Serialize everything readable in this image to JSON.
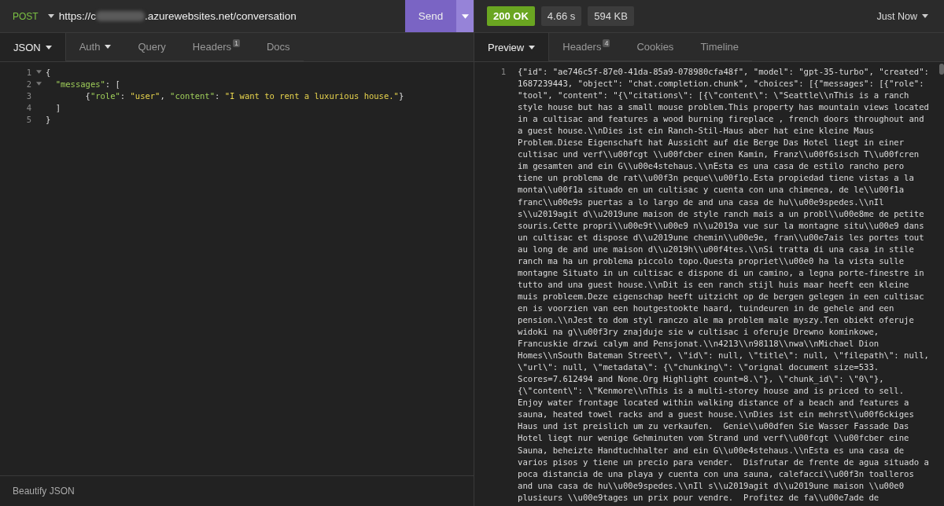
{
  "request": {
    "method": "POST",
    "url_start": "https://c",
    "url_end": ".azurewebsites.net/conversation",
    "send": "Send"
  },
  "request_tabs": [
    {
      "label": "JSON",
      "selected": true,
      "dropdown": true
    },
    {
      "label": "Auth",
      "selected": false,
      "dropdown": true
    },
    {
      "label": "Query",
      "selected": false,
      "dropdown": false
    },
    {
      "label": "Headers",
      "selected": false,
      "dropdown": false,
      "badge": "1"
    },
    {
      "label": "Docs",
      "selected": false,
      "dropdown": false
    }
  ],
  "editor": {
    "lines": [
      {
        "number": "1",
        "foldable": true,
        "tokens": [
          {
            "text": "{",
            "kind": "punct"
          }
        ]
      },
      {
        "number": "2",
        "foldable": true,
        "tokens": [
          {
            "text": "  \"messages\"",
            "kind": "key"
          },
          {
            "text": ": [",
            "kind": "punct"
          }
        ]
      },
      {
        "number": "3",
        "foldable": false,
        "tokens": [
          {
            "text": "        {",
            "kind": "punct"
          },
          {
            "text": "\"role\"",
            "kind": "key"
          },
          {
            "text": ": ",
            "kind": "punct"
          },
          {
            "text": "\"user\"",
            "kind": "string"
          },
          {
            "text": ", ",
            "kind": "punct"
          },
          {
            "text": "\"content\"",
            "kind": "key"
          },
          {
            "text": ": ",
            "kind": "punct"
          },
          {
            "text": "\"I want to rent a luxurious house.\"",
            "kind": "string"
          },
          {
            "text": "}",
            "kind": "punct"
          }
        ]
      },
      {
        "number": "4",
        "foldable": false,
        "tokens": [
          {
            "text": "  ]",
            "kind": "punct"
          }
        ]
      },
      {
        "number": "5",
        "foldable": false,
        "tokens": [
          {
            "text": "}",
            "kind": "punct"
          }
        ]
      }
    ],
    "footer": "Beautify JSON"
  },
  "response": {
    "status": "200 OK",
    "time": "4.66 s",
    "size": "594 KB",
    "when": "Just Now"
  },
  "response_tabs": [
    {
      "label": "Preview",
      "selected": true,
      "dropdown": true
    },
    {
      "label": "Headers",
      "selected": false,
      "dropdown": false,
      "badge": "4"
    },
    {
      "label": "Cookies",
      "selected": false,
      "dropdown": false
    },
    {
      "label": "Timeline",
      "selected": false,
      "dropdown": false
    }
  ],
  "preview": {
    "line_number": "1",
    "lines": [
      "{\"id\": \"ae746c5f-87e0-41da-85a9-078980cfa48f\", \"model\": \"gpt-35-turbo\", \"created\":",
      "1687239443, \"object\": \"chat.completion.chunk\", \"choices\": [{\"messages\": [{\"role\":",
      "\"tool\", \"content\": \"{\\\"citations\\\": [{\\\"content\\\": \\\"Seattle\\\\nThis is a ranch",
      "style house but has a small mouse problem.This property has mountain views located",
      "in a cultisac and features a wood burning fireplace , french doors throughout and",
      "a guest house.\\\\nDies ist ein Ranch-Stil-Haus aber hat eine kleine Maus",
      "Problem.Diese Eigenschaft hat Aussicht auf die Berge Das Hotel liegt in einer",
      "cultisac und verf\\\\u00fcgt \\\\u00fcber einen Kamin, Franz\\\\u00f6sisch T\\\\u00fcren",
      "im gesamten and ein G\\\\u00e4stehaus.\\\\nEsta es una casa de estilo rancho pero",
      "tiene un problema de rat\\\\u00f3n peque\\\\u00f1o.Esta propiedad tiene vistas a la",
      "monta\\\\u00f1a situado en un cultisac y cuenta con una chimenea, de le\\\\u00f1a",
      "franc\\\\u00e9s puertas a lo largo de and una casa de hu\\\\u00e9spedes.\\\\nIl",
      "s\\\\u2019agit d\\\\u2019une maison de style ranch mais a un probl\\\\u00e8me de petite",
      "souris.Cette propri\\\\u00e9t\\\\u00e9 n\\\\u2019a vue sur la montagne situ\\\\u00e9 dans",
      "un cultisac et dispose d\\\\u2019une chemin\\\\u00e9e, fran\\\\u00e7ais les portes tout",
      "au long de and une maison d\\\\u2019h\\\\u00f4tes.\\\\nSi tratta di una casa in stile",
      "ranch ma ha un problema piccolo topo.Questa propriet\\\\u00e0 ha la vista sulle",
      "montagne Situato in un cultisac e dispone di un camino, a legna porte-finestre in",
      "tutto and una guest house.\\\\nDit is een ranch stijl huis maar heeft een kleine",
      "muis probleem.Deze eigenschap heeft uitzicht op de bergen gelegen in een cultisac",
      "en is voorzien van een houtgestookte haard, tuindeuren in de gehele and een",
      "pension.\\\\nJest to dom styl ranczo ale ma problem male myszy.Ten obiekt oferuje",
      "widoki na g\\\\u00f3ry znajduje sie w cultisac i oferuje Drewno kominkowe,",
      "Francuskie drzwi calym and Pensjonat.\\\\n4213\\\\n98118\\\\nwa\\\\nMichael Dion",
      "Homes\\\\nSouth Bateman Street\\\", \\\"id\\\": null, \\\"title\\\": null, \\\"filepath\\\": null,",
      "\\\"url\\\": null, \\\"metadata\\\": {\\\"chunking\\\": \\\"orignal document size=533.",
      "Scores=7.612494 and None.Org Highlight count=8.\\\"}, \\\"chunk_id\\\": \\\"0\\\"},",
      "{\\\"content\\\": \\\"Kenmore\\\\nThis is a multi-storey house and is priced to sell.",
      "Enjoy water frontage located within walking distance of a beach and features a",
      "sauna, heated towel racks and a guest house.\\\\nDies ist ein mehrst\\\\u00f6ckiges",
      "Haus und ist preislich um zu verkaufen.  Genie\\\\u00dfen Sie Wasser Fassade Das",
      "Hotel liegt nur wenige Gehminuten vom Strand und verf\\\\u00fcgt \\\\u00fcber eine",
      "Sauna, beheizte Handtuchhalter and ein G\\\\u00e4stehaus.\\\\nEsta es una casa de",
      "varios pisos y tiene un precio para vender.  Disfrutar de frente de agua situado a",
      "poca distancia de una playa y cuenta con una sauna, calefacci\\\\u00f3n toalleros",
      "and una casa de hu\\\\u00e9spedes.\\\\nIl s\\\\u2019agit d\\\\u2019une maison \\\\u00e0",
      "plusieurs \\\\u00e9tages un prix pour vendre.  Profitez de fa\\\\u00e7ade de"
    ]
  }
}
